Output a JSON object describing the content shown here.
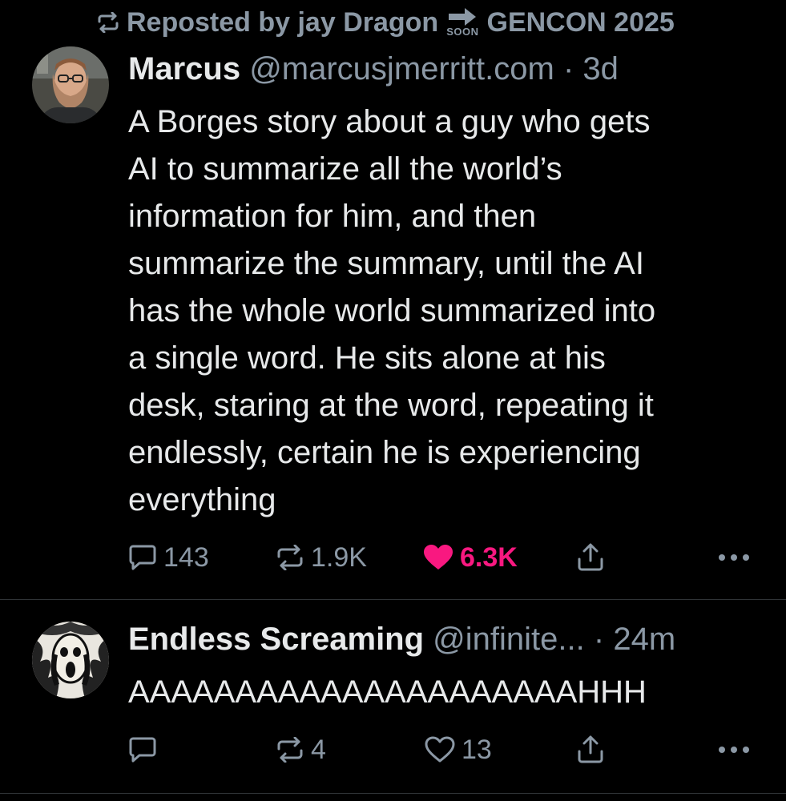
{
  "repost": {
    "text": "Reposted by jay Dragon",
    "badge_small": "SOON",
    "badge_tail": "GENCON 2025",
    "icon": "repost-icon"
  },
  "posts": [
    {
      "display_name": "Marcus",
      "handle": "@marcusjmerritt.com",
      "separator": "·",
      "time": "3d",
      "text": "A Borges story about a guy who gets\nAI to summarize all the world’s\ninformation for him, and then\nsummarize the summary, until the AI\nhas the whole world summarized into\na single word. He sits alone at his\ndesk, staring at the word, repeating it\nendlessly, certain he is experiencing\neverything",
      "replies": "143",
      "reposts": "1.9K",
      "likes": "6.3K",
      "liked": true
    },
    {
      "display_name": "Endless Screaming",
      "handle": "@infinite...",
      "separator": "·",
      "time": "24m",
      "text": "AAAAAAAAAAAAAAAAAAAAAHHH",
      "replies": "",
      "reposts": "4",
      "likes": "13",
      "liked": false
    }
  ],
  "colors": {
    "background": "#000000",
    "text": "#e7e9ea",
    "muted": "#8b98a5",
    "like": "#f91880",
    "divider": "#2f3336"
  }
}
